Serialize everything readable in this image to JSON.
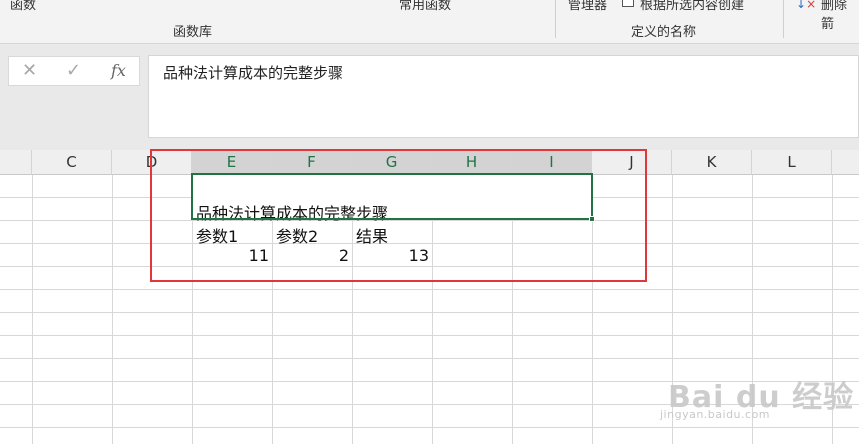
{
  "ribbon": {
    "group_function_cut": "函数",
    "group_function_label": "函数库",
    "common_functions_cut": "常用函数",
    "name_manager_cut": "管理器",
    "create_from_selection": "根据所选内容创建",
    "defined_names_label": "定义的名称",
    "delete_cut": "删除箭",
    "doc-icon": "create-from-selection-icon",
    "delete-icon": "remove-arrows-icon"
  },
  "formula_bar": {
    "cancel_icon": "✕",
    "enter_icon": "✓",
    "fx_icon": "fx",
    "value": "品种法计算成本的完整步骤"
  },
  "columns": [
    "C",
    "D",
    "E",
    "F",
    "G",
    "H",
    "I",
    "J",
    "K",
    "L"
  ],
  "cells": {
    "title": "品种法计算成本的完整步骤",
    "param1_label": "参数1",
    "param2_label": "参数2",
    "result_label": "结果",
    "param1_value": "11",
    "param2_value": "2",
    "result_value": "13"
  },
  "watermark": {
    "logo": "Bai du 经验",
    "url": "jingyan.baidu.com"
  },
  "colors": {
    "selection": "#217346",
    "highlight_box": "#e0373a"
  }
}
